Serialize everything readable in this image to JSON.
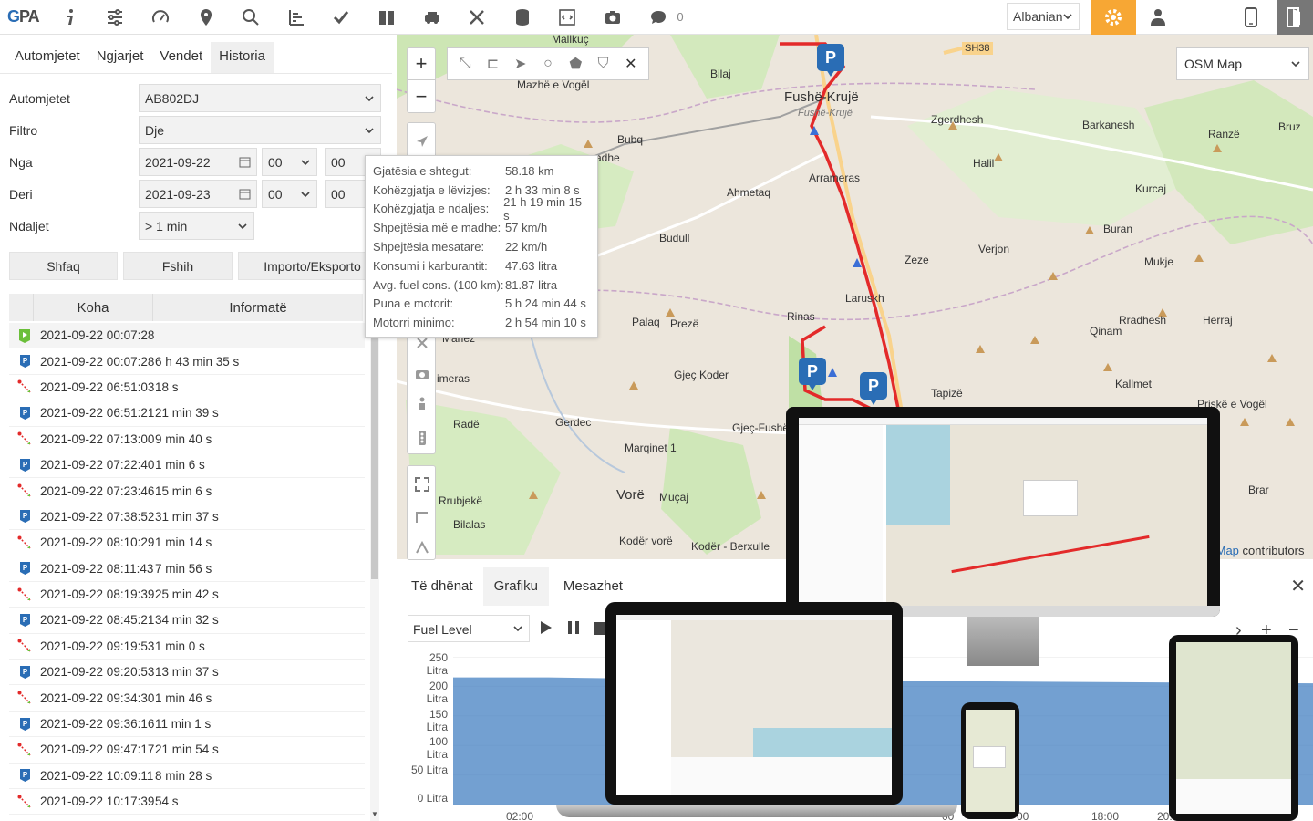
{
  "toolbar": {
    "logo_a": "G",
    "logo_b": "PA",
    "icons": [
      "info-icon",
      "sliders-icon",
      "gauge-icon",
      "map-pin-icon",
      "search-icon",
      "chart-icon",
      "check-icon",
      "book-icon",
      "car-icon",
      "tools-icon",
      "database-icon",
      "code-icon",
      "camera-icon",
      "chat-icon"
    ],
    "chat_count": "0",
    "language": "Albanian"
  },
  "left": {
    "tabs": [
      "Automjetet",
      "Ngjarjet",
      "Vendet",
      "Historia"
    ],
    "active_tab": "Historia",
    "form": {
      "vehicles_label": "Automjetet",
      "vehicles_value": "AB802DJ",
      "filter_label": "Filtro",
      "filter_value": "Dje",
      "from_label": "Nga",
      "from_date": "2021-09-22",
      "from_hour": "00",
      "from_min": "00",
      "to_label": "Deri",
      "to_date": "2021-09-23",
      "to_hour": "00",
      "to_min": "00",
      "stops_label": "Ndaljet",
      "stops_value": "> 1 min"
    },
    "buttons": {
      "show": "Shfaq",
      "delete": "Fshih",
      "import_export": "Importo/Eksporto"
    },
    "table": {
      "headers": [
        "Koha",
        "Informatë"
      ],
      "rows": [
        {
          "type": "start",
          "time": "2021-09-22 00:07:28",
          "info": ""
        },
        {
          "type": "park",
          "time": "2021-09-22 00:07:28",
          "info": "6 h 43 min 35 s"
        },
        {
          "type": "move",
          "time": "2021-09-22 06:51:03",
          "info": "18 s"
        },
        {
          "type": "park",
          "time": "2021-09-22 06:51:21",
          "info": "21 min 39 s"
        },
        {
          "type": "move",
          "time": "2021-09-22 07:13:00",
          "info": "9 min 40 s"
        },
        {
          "type": "park",
          "time": "2021-09-22 07:22:40",
          "info": "1 min 6 s"
        },
        {
          "type": "move",
          "time": "2021-09-22 07:23:46",
          "info": "15 min 6 s"
        },
        {
          "type": "park",
          "time": "2021-09-22 07:38:52",
          "info": "31 min 37 s"
        },
        {
          "type": "move",
          "time": "2021-09-22 08:10:29",
          "info": "1 min 14 s"
        },
        {
          "type": "park",
          "time": "2021-09-22 08:11:43",
          "info": "7 min 56 s"
        },
        {
          "type": "move",
          "time": "2021-09-22 08:19:39",
          "info": "25 min 42 s"
        },
        {
          "type": "park",
          "time": "2021-09-22 08:45:21",
          "info": "34 min 32 s"
        },
        {
          "type": "move",
          "time": "2021-09-22 09:19:53",
          "info": "1 min 0 s"
        },
        {
          "type": "park",
          "time": "2021-09-22 09:20:53",
          "info": "13 min 37 s"
        },
        {
          "type": "move",
          "time": "2021-09-22 09:34:30",
          "info": "1 min 46 s"
        },
        {
          "type": "park",
          "time": "2021-09-22 09:36:16",
          "info": "11 min 1 s"
        },
        {
          "type": "move",
          "time": "2021-09-22 09:47:17",
          "info": "21 min 54 s"
        },
        {
          "type": "park",
          "time": "2021-09-22 10:09:11",
          "info": "8 min 28 s"
        },
        {
          "type": "move",
          "time": "2021-09-22 10:17:39",
          "info": "54 s"
        }
      ]
    }
  },
  "map": {
    "layer": "OSM Map",
    "attribution_link": "tMap",
    "attribution_rest": " contributors",
    "places": [
      {
        "name": "Mallkuç"
      },
      {
        "name": "Bilaj"
      },
      {
        "name": "SH38"
      },
      {
        "name": "Fushë-Krujë"
      },
      {
        "name": "Fushë-Krujë",
        "italic": true
      },
      {
        "name": "Mazhë e Vogël"
      },
      {
        "name": "Zgerdhesh"
      },
      {
        "name": "Barkanesh"
      },
      {
        "name": "Ranzë"
      },
      {
        "name": "Bruz"
      },
      {
        "name": "Bubq"
      },
      {
        "name": "adhe"
      },
      {
        "name": "Halil"
      },
      {
        "name": "Arrameras"
      },
      {
        "name": "Ahmetaq"
      },
      {
        "name": "Kurcaj"
      },
      {
        "name": "Buran"
      },
      {
        "name": "Budull"
      },
      {
        "name": "Verjon"
      },
      {
        "name": "Mukje"
      },
      {
        "name": "Zeze"
      },
      {
        "name": "Laruskh"
      },
      {
        "name": "Rinas"
      },
      {
        "name": "Palaq"
      },
      {
        "name": "Prezë"
      },
      {
        "name": "Qinam"
      },
      {
        "name": "Rradhesh"
      },
      {
        "name": "Herraj"
      },
      {
        "name": "Marlez"
      },
      {
        "name": "imeras"
      },
      {
        "name": "Gjeç Koder"
      },
      {
        "name": "Kallmet"
      },
      {
        "name": "Tapizë"
      },
      {
        "name": "Priskë e Vogël"
      },
      {
        "name": "Radë"
      },
      {
        "name": "Gerdec"
      },
      {
        "name": "Gjeç-Fushë"
      },
      {
        "name": "Marqinet 1"
      },
      {
        "name": "Rrubjekë"
      },
      {
        "name": "Vorë"
      },
      {
        "name": "Muçaj"
      },
      {
        "name": "Bilalas"
      },
      {
        "name": "Kodër vorë"
      },
      {
        "name": "Kodër - Berxulle"
      },
      {
        "name": "Brar"
      }
    ],
    "parking_label": "P"
  },
  "popup": {
    "rows": [
      {
        "k": "Gjatësia e shtegut:",
        "v": "58.18 km"
      },
      {
        "k": "Kohëzgjatja e lëvizjes:",
        "v": "2 h 33 min 8 s"
      },
      {
        "k": "Kohëzgjatja e ndaljes:",
        "v": "21 h 19 min 15 s"
      },
      {
        "k": "Shpejtësia më e madhe:",
        "v": "57 km/h"
      },
      {
        "k": "Shpejtësia mesatare:",
        "v": "22 km/h"
      },
      {
        "k": "Konsumi i karburantit:",
        "v": "47.63 litra"
      },
      {
        "k": "Avg. fuel cons. (100 km):",
        "v": "81.87 litra"
      },
      {
        "k": "Puna e motorit:",
        "v": "5 h 24 min 44 s"
      },
      {
        "k": "Motorri minimo:",
        "v": "2 h 54 min 10 s"
      }
    ]
  },
  "bottom": {
    "tabs": [
      "Të dhënat",
      "Grafiku",
      "Mesazhet"
    ],
    "active_tab": "Grafiku",
    "close": "✕",
    "series_select": "Fuel Level"
  },
  "chart_data": {
    "type": "area",
    "yticks": [
      "250 Litra",
      "200 Litra",
      "150 Litra",
      "100 Litra",
      "50 Litra",
      "0 Litra"
    ],
    "xticks": [
      "02:00",
      "00",
      "00",
      "18:00",
      "20:"
    ],
    "ylim": [
      0,
      250
    ],
    "series": [
      {
        "values": [
          215,
          215,
          213,
          212,
          210,
          209,
          208,
          207,
          206,
          205
        ]
      }
    ],
    "color": "#5b8fc9"
  }
}
